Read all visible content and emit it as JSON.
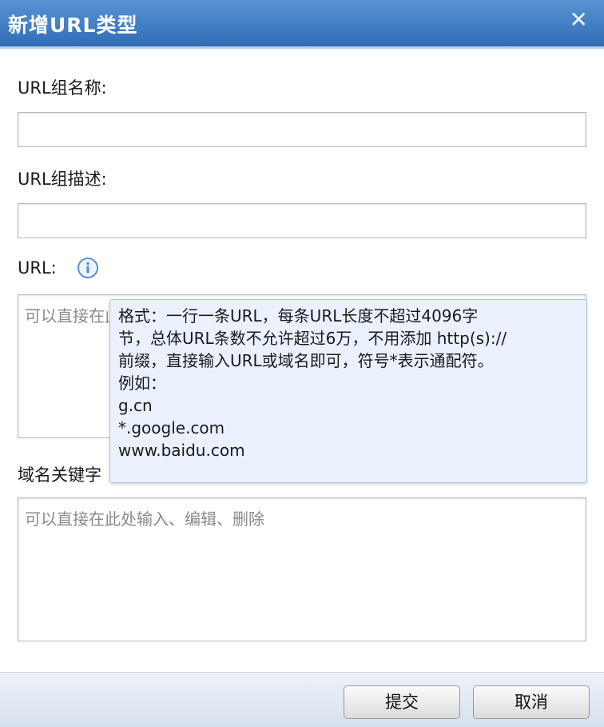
{
  "dialog": {
    "title": "新增URL类型",
    "close_glyph": "✕"
  },
  "form": {
    "group_name_label": "URL组名称:",
    "group_desc_label": "URL组描述:",
    "url_label": "URL:",
    "url_placeholder": "可以直接在此处输入、编辑、删除",
    "domain_keyword_label": "域名关键字",
    "domain_keyword_placeholder": "可以直接在此处输入、编辑、删除"
  },
  "tooltip": {
    "lines": [
      "格式：一行一条URL，每条URL长度不超过4096字",
      "节，总体URL条数不允许超过6万，不用添加 http(s)://",
      "前缀，直接输入URL或域名即可，符号*表示通配符。",
      "例如：",
      "g.cn",
      "*.google.com",
      "www.baidu.com"
    ]
  },
  "buttons": {
    "submit": "提交",
    "cancel": "取消"
  },
  "icons": {
    "info": "info-icon",
    "close": "close-icon"
  },
  "colors": {
    "titlebar": "#2f6db6",
    "tooltip_bg": "#eaf1fd",
    "info_icon": "#5b8fd0"
  }
}
